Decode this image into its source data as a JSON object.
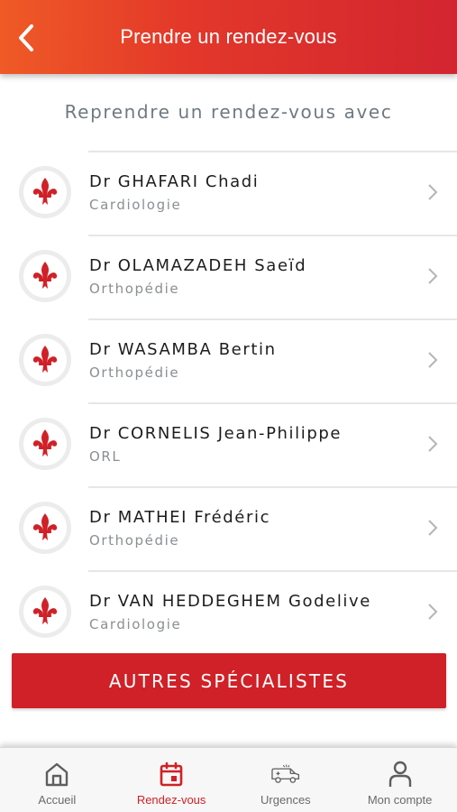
{
  "header": {
    "title": "Prendre un rendez-vous"
  },
  "subtitle": "Reprendre un rendez-vous avec",
  "doctors": [
    {
      "name": "Dr GHAFARI Chadi",
      "specialty": "Cardiologie"
    },
    {
      "name": "Dr OLAMAZADEH Saeïd",
      "specialty": "Orthopédie"
    },
    {
      "name": "Dr WASAMBA Bertin",
      "specialty": "Orthopédie"
    },
    {
      "name": "Dr CORNELIS Jean-Philippe",
      "specialty": "ORL"
    },
    {
      "name": "Dr MATHEI Frédéric",
      "specialty": "Orthopédie"
    },
    {
      "name": "Dr VAN HEDDEGHEM Godelive",
      "specialty": "Cardiologie"
    }
  ],
  "cta_label": "AUTRES SPÉCIALISTES",
  "tabs": [
    {
      "label": "Accueil",
      "icon": "home-icon",
      "active": false
    },
    {
      "label": "Rendez-vous",
      "icon": "calendar-icon",
      "active": true
    },
    {
      "label": "Urgences",
      "icon": "ambulance-icon",
      "active": false
    },
    {
      "label": "Mon compte",
      "icon": "user-icon",
      "active": false
    }
  ],
  "colors": {
    "accent": "#cf2127",
    "header_start": "#ef5a26",
    "header_end": "#d22530",
    "muted": "#8a8f92"
  }
}
